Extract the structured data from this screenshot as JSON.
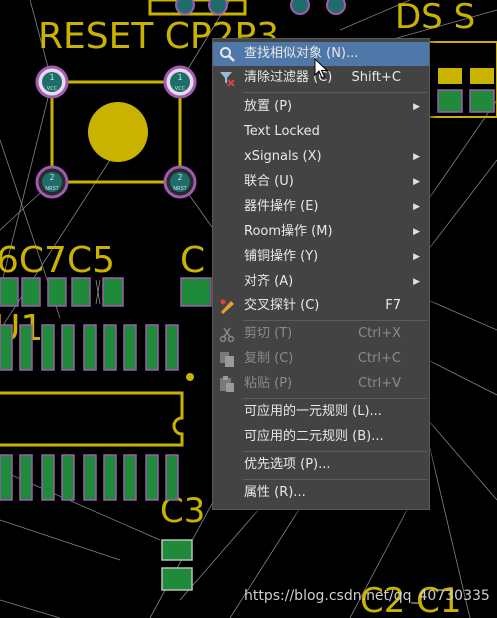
{
  "canvas": {
    "designators": {
      "reset_cp": "RESET CP2P3",
      "top_right": "DS S",
      "caps": "6C7C5",
      "c_partial": "C",
      "u1": "U1",
      "c3": "C3",
      "c2c1": "C2 C1"
    },
    "pad_labels": {
      "pad1": "1",
      "pad2": "2",
      "net_vcc": "VCC",
      "net_nrst": "NRST"
    }
  },
  "context_menu": {
    "items": [
      {
        "label": "查找相似对象 (N)...",
        "shortcut": "",
        "submenu": false,
        "icon": "search-icon",
        "highlighted": true,
        "disabled": false
      },
      {
        "label": "清除过滤器 (C)",
        "shortcut": "Shift+C",
        "submenu": false,
        "icon": "clear-filter-icon",
        "highlighted": false,
        "disabled": false
      },
      {
        "label": "放置 (P)",
        "shortcut": "",
        "submenu": true,
        "icon": "",
        "highlighted": false,
        "disabled": false
      },
      {
        "label": "Text Locked",
        "shortcut": "",
        "submenu": false,
        "icon": "",
        "highlighted": false,
        "disabled": false
      },
      {
        "label": "xSignals (X)",
        "shortcut": "",
        "submenu": true,
        "icon": "",
        "highlighted": false,
        "disabled": false
      },
      {
        "label": "联合 (U)",
        "shortcut": "",
        "submenu": true,
        "icon": "",
        "highlighted": false,
        "disabled": false
      },
      {
        "label": "器件操作 (E)",
        "shortcut": "",
        "submenu": true,
        "icon": "",
        "highlighted": false,
        "disabled": false
      },
      {
        "label": "Room操作 (M)",
        "shortcut": "",
        "submenu": true,
        "icon": "",
        "highlighted": false,
        "disabled": false
      },
      {
        "label": "铺铜操作 (Y)",
        "shortcut": "",
        "submenu": true,
        "icon": "",
        "highlighted": false,
        "disabled": false
      },
      {
        "label": "对齐 (A)",
        "shortcut": "",
        "submenu": true,
        "icon": "",
        "highlighted": false,
        "disabled": false
      },
      {
        "label": "交叉探针 (C)",
        "shortcut": "F7",
        "submenu": false,
        "icon": "cross-probe-icon",
        "highlighted": false,
        "disabled": false
      },
      {
        "label": "剪切 (T)",
        "shortcut": "Ctrl+X",
        "submenu": false,
        "icon": "scissors-icon",
        "highlighted": false,
        "disabled": true
      },
      {
        "label": "复制 (C)",
        "shortcut": "Ctrl+C",
        "submenu": false,
        "icon": "copy-icon",
        "highlighted": false,
        "disabled": true
      },
      {
        "label": "粘贴 (P)",
        "shortcut": "Ctrl+V",
        "submenu": false,
        "icon": "paste-icon",
        "highlighted": false,
        "disabled": true
      },
      {
        "label": "可应用的一元规则 (L)...",
        "shortcut": "",
        "submenu": false,
        "icon": "",
        "highlighted": false,
        "disabled": false
      },
      {
        "label": "可应用的二元规则 (B)...",
        "shortcut": "",
        "submenu": false,
        "icon": "",
        "highlighted": false,
        "disabled": false
      },
      {
        "label": "优先选项 (P)...",
        "shortcut": "",
        "submenu": false,
        "icon": "",
        "highlighted": false,
        "disabled": false
      },
      {
        "label": "属性 (R)...",
        "shortcut": "",
        "submenu": false,
        "icon": "",
        "highlighted": false,
        "disabled": false
      }
    ]
  },
  "watermark": "https://blog.csdn.net/qq_40730335",
  "colors": {
    "background": "#000000",
    "silkscreen": "#c9b300",
    "pad_green": "#1f8a3a",
    "pad_outline": "#a05ab0",
    "menu_bg": "#434343",
    "menu_highlight": "#4f78a8",
    "menu_text": "#e8e8e8",
    "menu_disabled": "#8a8a8a"
  }
}
